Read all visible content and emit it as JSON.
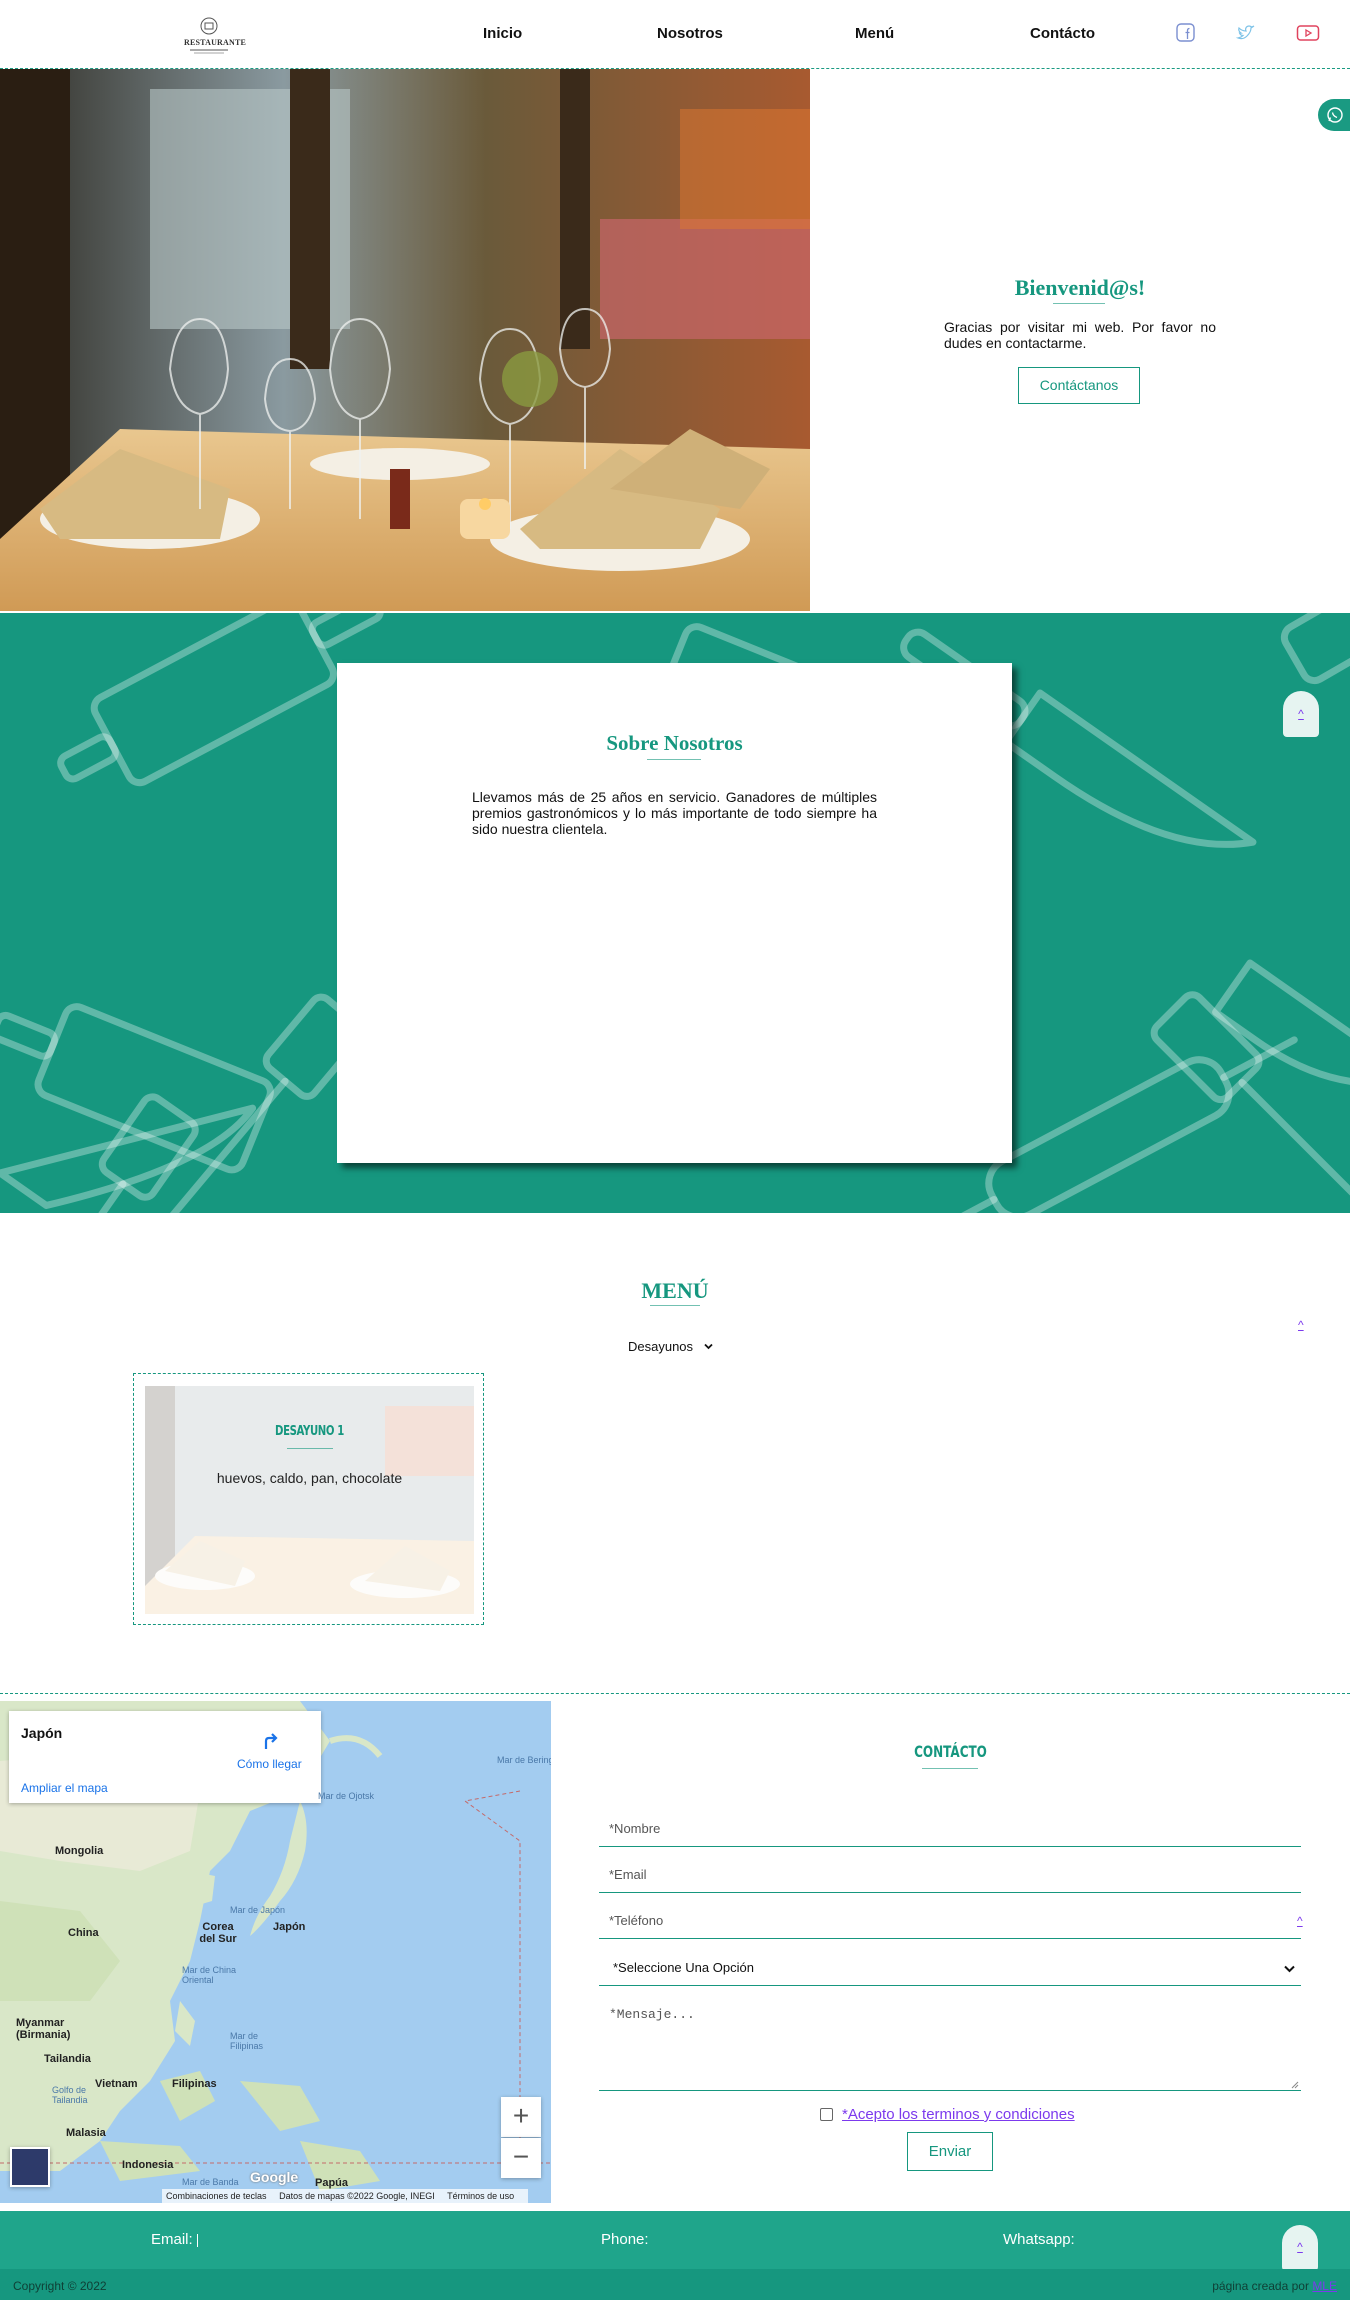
{
  "header": {
    "logo_text": "RESTAURANTE",
    "nav": [
      "Inicio",
      "Nosotros",
      "Menú",
      "Contácto"
    ],
    "social_icons": [
      "facebook-icon",
      "twitter-icon",
      "youtube-icon"
    ]
  },
  "hero": {
    "title": "Bienvenid@s!",
    "text": "Gracias por visitar mi web. Por favor no dudes en contactarme.",
    "button": "Contáctanos"
  },
  "about": {
    "title": "Sobre Nosotros",
    "text": "Llevamos más de 25 años en servicio. Ganadores de múltiples premios gastronómicos y lo más importante de todo siempre ha sido nuestra clientela.",
    "up_label": "^"
  },
  "menu": {
    "title": "MENÚ",
    "select_value": "Desayunos",
    "up_label": "^",
    "items": [
      {
        "title": "DESAYUNO 1",
        "description": "huevos, caldo, pan, chocolate"
      }
    ]
  },
  "map": {
    "place": "Japón",
    "directions": "Cómo llegar",
    "enlarge": "Ampliar el mapa",
    "labels": [
      "Mongolia",
      "China",
      "Corea del Sur",
      "Japón",
      "Myanmar (Birmania)",
      "Tailandia",
      "Vietnam",
      "Filipinas",
      "Malasia",
      "Indonesia",
      "Papúa"
    ],
    "seas": [
      "Mar de Japón",
      "Mar de Ojotsk",
      "Mar de Bering",
      "Mar de China Oriental",
      "Mar de Filipinas",
      "Golfo de Tailandia",
      "Mar de Banda"
    ],
    "zoom_in": "+",
    "zoom_out": "−",
    "google": "Google",
    "footer": [
      "Combinaciones de teclas",
      "Datos de mapas ©2022 Google, INEGI",
      "Términos de uso"
    ]
  },
  "contact": {
    "title": "CONTÁCTO",
    "name_placeholder": "*Nombre",
    "email_placeholder": "*Email",
    "phone_placeholder": "*Teléfono",
    "select_value": "*Seleccione Una Opción",
    "message_placeholder": "*Mensaje...",
    "terms": "*Acepto los terminos y condiciones",
    "submit": "Enviar",
    "up_label": "^"
  },
  "footer": {
    "email_label": "Email:",
    "phone_label": "Phone:",
    "whatsapp_label": "Whatsapp:",
    "up_label": "^",
    "copyright": "Copyright © 2022",
    "credit_prefix": "página creada por",
    "credit_link": "MLE"
  },
  "colors": {
    "accent": "#16977f",
    "footer": "#1fa58b",
    "link": "#7c3aed"
  }
}
